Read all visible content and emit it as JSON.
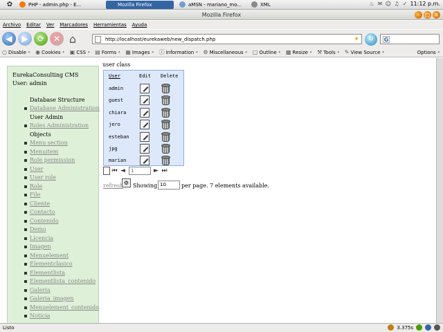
{
  "taskbar": {
    "tasks": [
      {
        "label": "PHP - admin.php - E...",
        "active": false
      },
      {
        "label": "Mozilla Firefox",
        "active": true
      },
      {
        "label": "aMSN - mariano_mo...",
        "active": false
      },
      {
        "label": "XML",
        "active": false
      }
    ],
    "clock": "11:12 p.m."
  },
  "window": {
    "title": "Mozilla Firefox"
  },
  "menubar": [
    "Archivo",
    "Editar",
    "Ver",
    "Marcadores",
    "Herramientas",
    "Ayuda"
  ],
  "address": {
    "url": "http://localhost/eurekaweb/new_dispatch.php",
    "search_placeholder": ""
  },
  "devbar": {
    "items": [
      {
        "icon": "disable-icon",
        "label": "Disable"
      },
      {
        "icon": "cookies-icon",
        "label": "Cookies"
      },
      {
        "icon": "css-icon",
        "label": "CSS"
      },
      {
        "icon": "forms-icon",
        "label": "Forms"
      },
      {
        "icon": "images-icon",
        "label": "Images"
      },
      {
        "icon": "information-icon",
        "label": "Information"
      },
      {
        "icon": "miscellaneous-icon",
        "label": "Miscellaneous"
      },
      {
        "icon": "outline-icon",
        "label": "Outline"
      },
      {
        "icon": "resize-icon",
        "label": "Resize"
      },
      {
        "icon": "tools-icon",
        "label": "Tools"
      },
      {
        "icon": "view-source-icon",
        "label": "View Source"
      }
    ],
    "options": "Options"
  },
  "sidebar": {
    "cms_title": "EurekaConsulting CMS",
    "user_line": "User: admin",
    "db_section": "Database Structure",
    "items": [
      {
        "label": "Database Administration",
        "kind": "link"
      },
      {
        "label": "User Admin",
        "kind": "text"
      },
      {
        "label": "Roles Administration",
        "kind": "link"
      },
      {
        "label": "Objects",
        "kind": "text"
      },
      {
        "label": "Menu section",
        "kind": "link"
      },
      {
        "label": "Menuitem",
        "kind": "link"
      },
      {
        "label": "Role permission",
        "kind": "link"
      },
      {
        "label": "User",
        "kind": "link"
      },
      {
        "label": "User role",
        "kind": "link"
      },
      {
        "label": "Role",
        "kind": "link"
      },
      {
        "label": "File",
        "kind": "link"
      },
      {
        "label": "Cliente",
        "kind": "link"
      },
      {
        "label": "Contacto",
        "kind": "link"
      },
      {
        "label": "Contenido",
        "kind": "link"
      },
      {
        "label": "Demo",
        "kind": "link"
      },
      {
        "label": "Licencia",
        "kind": "link"
      },
      {
        "label": "Imagen",
        "kind": "link"
      },
      {
        "label": "Menuelement",
        "kind": "link"
      },
      {
        "label": "Elementclasico",
        "kind": "link"
      },
      {
        "label": "Elementlista",
        "kind": "link"
      },
      {
        "label": "Elementlista_contenido",
        "kind": "link"
      },
      {
        "label": "Galeria",
        "kind": "link"
      },
      {
        "label": "Galeria_imagen",
        "kind": "link"
      },
      {
        "label": "Menuelement_contenido",
        "kind": "link"
      },
      {
        "label": "Noticia",
        "kind": "link"
      }
    ]
  },
  "main": {
    "class_label": "user class",
    "table": {
      "headers": {
        "user": "User",
        "edit": "Edit",
        "delete": "Delete"
      },
      "rows": [
        "admin",
        "guest",
        "chiara",
        "jero",
        "esteban",
        "jpg",
        "marian"
      ]
    },
    "pager": {
      "page": "1"
    },
    "refresh_label": "refresh",
    "showing_label": "Showing",
    "per_page_value": "10",
    "per_page_text": "per page. 7 elements available."
  },
  "status": {
    "left": "Listo",
    "timing": "3.375s"
  }
}
